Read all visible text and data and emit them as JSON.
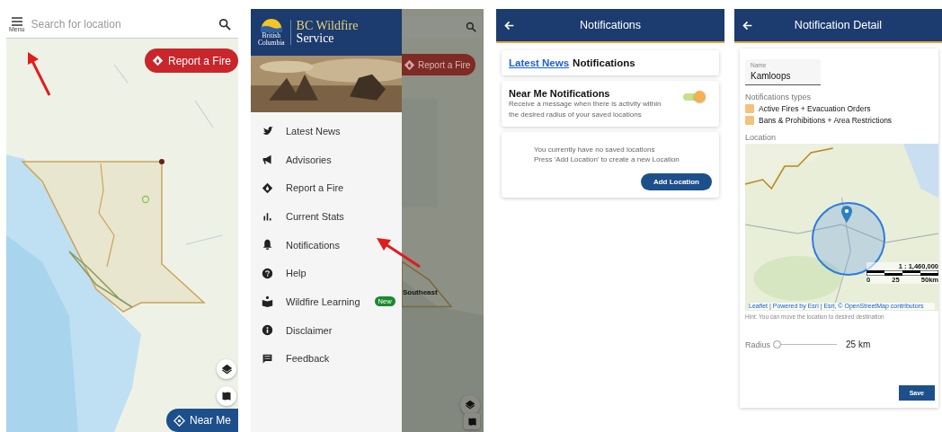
{
  "map_screen": {
    "menu_label": "Menu",
    "search": {
      "placeholder": "Search for location"
    },
    "report_button": "Report a Fire",
    "near_me_button": "Near Me"
  },
  "menu_screen": {
    "logo": {
      "crown_top": "British",
      "crown_bottom": "Columbia",
      "name_line1": "BC Wildfire",
      "name_line2": "Service"
    },
    "items": [
      {
        "label": "Latest News",
        "kind": "bird"
      },
      {
        "label": "Advisories",
        "kind": "megaphone"
      },
      {
        "label": "Report a Fire",
        "kind": "fire"
      },
      {
        "label": "Current Stats",
        "kind": "bars"
      },
      {
        "label": "Notifications",
        "kind": "bell"
      },
      {
        "label": "Help",
        "kind": "help"
      },
      {
        "label": "Wildfire Learning",
        "kind": "reader",
        "badge": "New"
      },
      {
        "label": "Disclaimer",
        "kind": "info"
      },
      {
        "label": "Feedback",
        "kind": "comment"
      }
    ],
    "background_button": "Report a Fire",
    "background_label": "Southeast"
  },
  "notifications_screen": {
    "title": "Notifications",
    "link": "Latest News",
    "link_suffix": "Notifications",
    "near_me": {
      "title": "Near Me Notifications",
      "description": "Receive a message when there is activity within the desired radius of your saved locations",
      "on": true
    },
    "empty_message": [
      "You currently have no saved locations",
      "Press 'Add Location' to create a new Location"
    ],
    "add_button": "Add Location"
  },
  "detail_screen": {
    "title": "Notification Detail",
    "name_field": {
      "label": "Name",
      "value": "Kamloops"
    },
    "types_label": "Notifications types",
    "types": [
      {
        "label": "Active Fires + Evacuation Orders",
        "checked": true
      },
      {
        "label": "Bans & Prohibitions + Area Restrictions",
        "checked": true
      }
    ],
    "location_label": "Location",
    "map": {
      "scale": "1 : 1,460,000",
      "scale_ticks": [
        "0",
        "25",
        "50km"
      ],
      "attribution": "Leaflet | Powered by Esri | Esri, © OpenStreetMap contributors"
    },
    "hint": "Hint: You can move the location to desired destination",
    "radius": {
      "label": "Radius",
      "level": 0,
      "reading": "25 km"
    },
    "save_button": "Save"
  }
}
